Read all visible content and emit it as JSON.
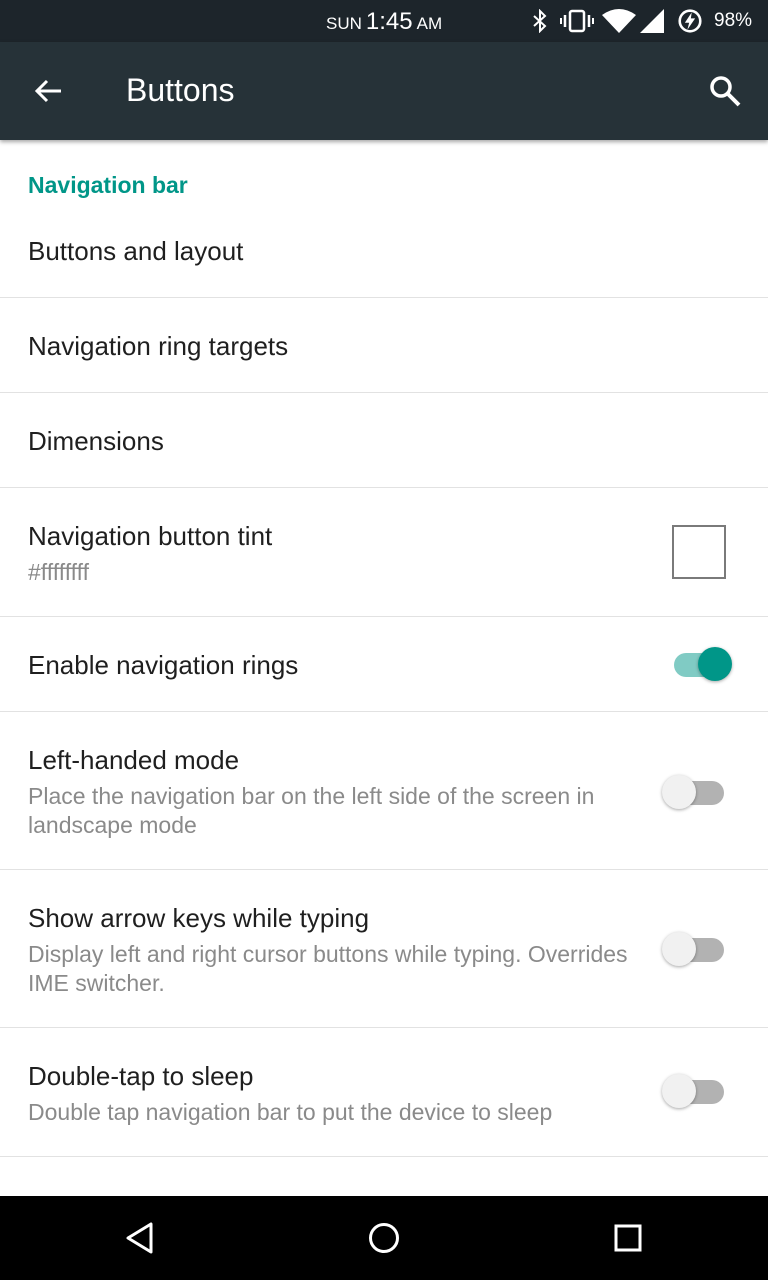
{
  "status_bar": {
    "day": "SUN",
    "time": "1:45",
    "ampm": "AM",
    "battery_percent": "98%",
    "icons": [
      "bluetooth-icon",
      "vibrate-icon",
      "wifi-icon",
      "cell-signal-icon",
      "battery-charging-icon"
    ]
  },
  "app_bar": {
    "title": "Buttons",
    "back_icon": "arrow-back-icon",
    "search_icon": "search-icon"
  },
  "section": {
    "header": "Navigation bar"
  },
  "items": [
    {
      "title": "Buttons and layout"
    },
    {
      "title": "Navigation ring targets"
    },
    {
      "title": "Dimensions"
    },
    {
      "title": "Navigation button tint",
      "summary": "#ffffffff",
      "swatch_color": "#ffffff"
    },
    {
      "title": "Enable navigation rings",
      "switch_on": true
    },
    {
      "title": "Left-handed mode",
      "summary": "Place the navigation bar on the left side of the screen in landscape mode",
      "switch_on": false
    },
    {
      "title": "Show arrow keys while typing",
      "summary": "Display left and right cursor buttons while typing. Overrides IME switcher.",
      "switch_on": false
    },
    {
      "title": "Double-tap to sleep",
      "summary": "Double tap navigation bar to put the device to sleep",
      "switch_on": false
    }
  ],
  "colors": {
    "accent": "#009688",
    "app_bar": "#263238",
    "status_bar": "#1d252b"
  },
  "nav_bar": {
    "icons": [
      "back-triangle-icon",
      "home-circle-icon",
      "recents-square-icon"
    ]
  }
}
